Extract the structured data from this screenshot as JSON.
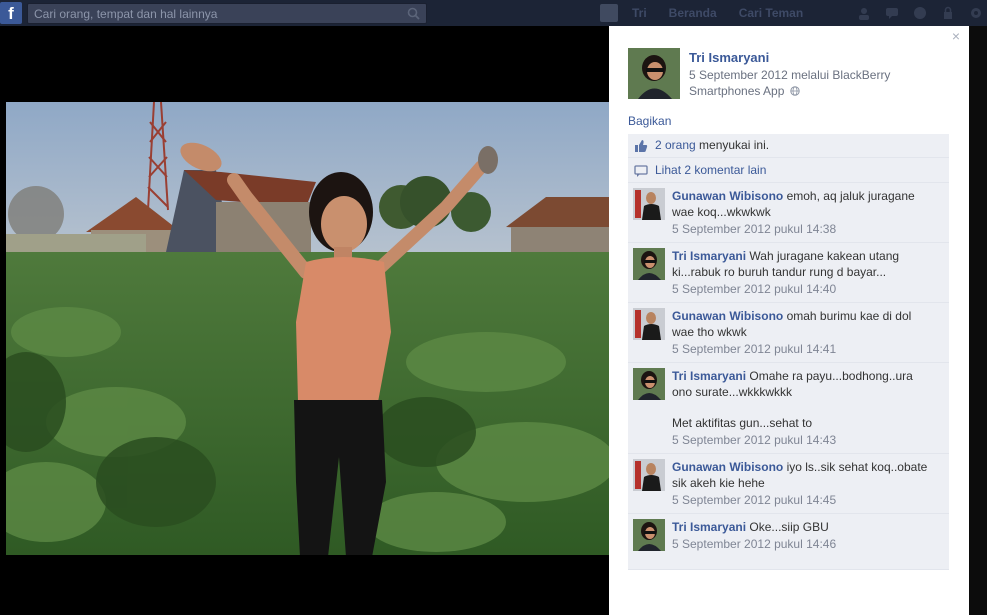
{
  "topbar": {
    "logo": "f",
    "search_placeholder": "Cari orang, tempat dan hal lainnya",
    "user_name": "Tri",
    "links": [
      "Beranda",
      "Cari Teman"
    ],
    "icons": [
      "friends-icon",
      "messages-icon",
      "notifications-icon",
      "privacy-icon",
      "settings-icon"
    ]
  },
  "photo": {
    "description_icon": "photo"
  },
  "panel": {
    "close": "×",
    "author": {
      "name": "Tri Ismaryani",
      "meta": "5 September 2012 melalui BlackBerry Smartphones App"
    },
    "share_label": "Bagikan",
    "likes": {
      "count_link": "2 orang",
      "suffix": " menyukai ini."
    },
    "more_comments": "Lihat 2 komentar lain",
    "comments": [
      {
        "author": "Gunawan Wibisono",
        "text": "emoh, aq jaluk juragane wae koq...wkwkwk",
        "extra": "",
        "time": "5 September 2012 pukul 14:38",
        "avatar": "man"
      },
      {
        "author": "Tri Ismaryani",
        "text": "Wah juragane kakean utang ki...rabuk ro buruh tandur rung d bayar...",
        "extra": "",
        "time": "5 September 2012 pukul 14:40",
        "avatar": "woman"
      },
      {
        "author": "Gunawan Wibisono",
        "text": "omah burimu kae di dol wae tho wkwk",
        "extra": "",
        "time": "5 September 2012 pukul 14:41",
        "avatar": "man"
      },
      {
        "author": "Tri Ismaryani",
        "text": "Omahe ra payu...bodhong..ura ono surate...wkkkwkkk",
        "extra": "Met aktifitas gun...sehat to",
        "time": "5 September 2012 pukul 14:43",
        "avatar": "woman"
      },
      {
        "author": "Gunawan Wibisono",
        "text": "iyo ls..sik sehat koq..obate sik akeh kie hehe",
        "extra": "",
        "time": "5 September 2012 pukul 14:45",
        "avatar": "man"
      },
      {
        "author": "Tri Ismaryani",
        "text": "Oke...siip GBU",
        "extra": "",
        "time": "5 September 2012 pukul 14:46",
        "avatar": "woman"
      }
    ]
  },
  "colors": {
    "link_blue": "#3b5998",
    "ufi_bg": "#edeff4",
    "topbar_bg": "#1c2436"
  }
}
